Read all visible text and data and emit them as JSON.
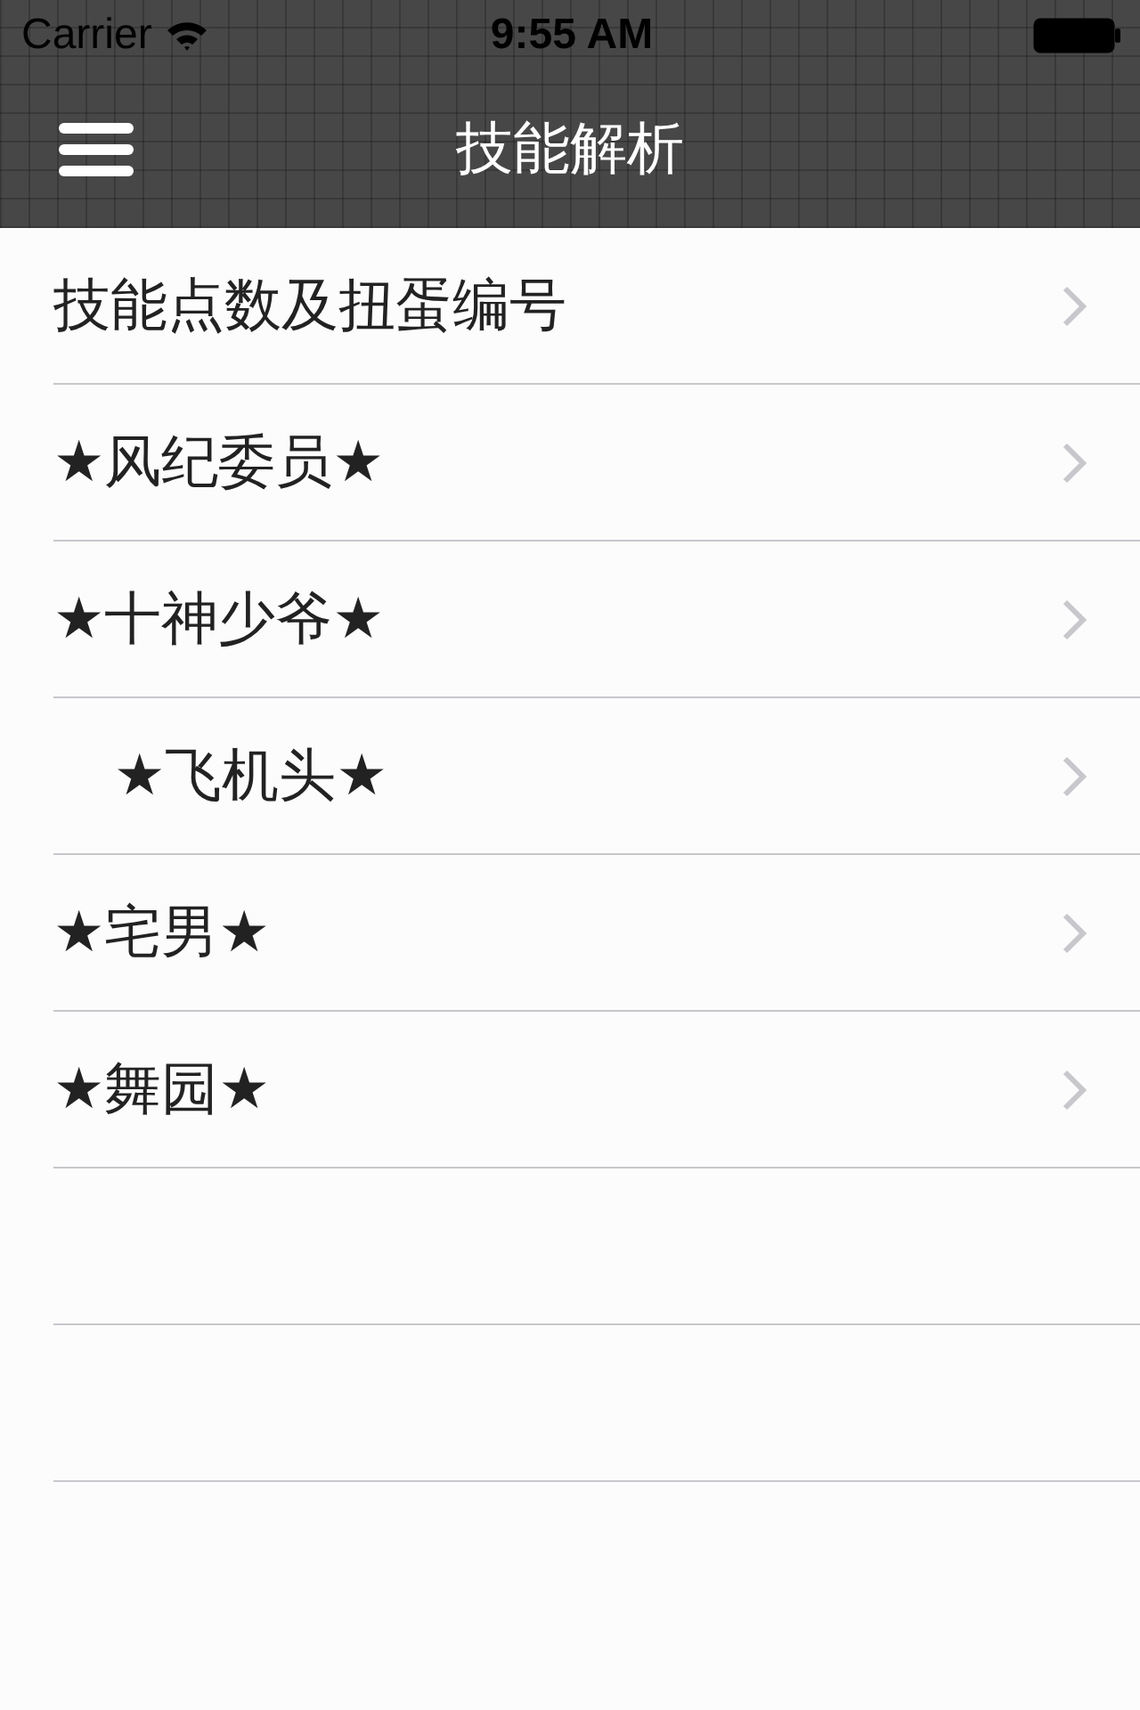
{
  "status_bar": {
    "carrier": "Carrier",
    "time": "9:55 AM"
  },
  "nav_bar": {
    "title": "技能解析"
  },
  "rows": [
    {
      "label": "技能点数及扭蛋编号",
      "indented": false
    },
    {
      "label": "★风纪委员★",
      "indented": false
    },
    {
      "label": "★十神少爷★",
      "indented": false
    },
    {
      "label": "★飞机头★",
      "indented": true
    },
    {
      "label": "★宅男★",
      "indented": false
    },
    {
      "label": "★舞园★",
      "indented": false
    }
  ]
}
